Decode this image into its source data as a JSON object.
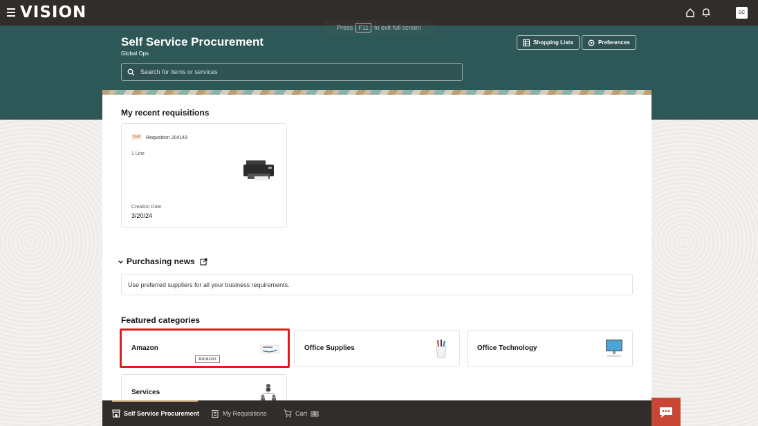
{
  "topbar": {
    "logo_text": "VISION",
    "fullscreen_hint_pre": "Press",
    "fullscreen_hint_key": "F11",
    "fullscreen_hint_post": "to exit full screen",
    "avatar_initials": "SC"
  },
  "header": {
    "title": "Self Service Procurement",
    "subtitle": "Global Ops",
    "search_placeholder": "Search for items or services",
    "shopping_lists_label": "Shopping Lists",
    "preferences_label": "Preferences"
  },
  "recent": {
    "heading": "My recent requisitions",
    "card": {
      "status": "Draft",
      "number": "Requisition 204143",
      "lines": "1 Line",
      "date_label": "Creation Date",
      "date_value": "3/20/24"
    }
  },
  "news": {
    "heading": "Purchasing news",
    "message": "Use preferred suppliers for all your business requirements."
  },
  "featured": {
    "heading": "Featured categories",
    "categories": [
      {
        "name": "Amazon",
        "icon": "amazon-logo-icon"
      },
      {
        "name": "Office Supplies",
        "icon": "pencil-cup-icon"
      },
      {
        "name": "Office Technology",
        "icon": "computer-monitor-icon"
      },
      {
        "name": "Services",
        "icon": "people-hierarchy-icon"
      }
    ],
    "tooltip": "Amazon"
  },
  "bottom_nav": {
    "items": [
      "Self Service Procurement",
      "My Requisitions",
      "Cart"
    ],
    "cart_count": "1"
  },
  "colors": {
    "topbar": "#312d2a",
    "hero": "#2e5858",
    "highlight": "#e11b1b",
    "chat": "#c74634"
  }
}
